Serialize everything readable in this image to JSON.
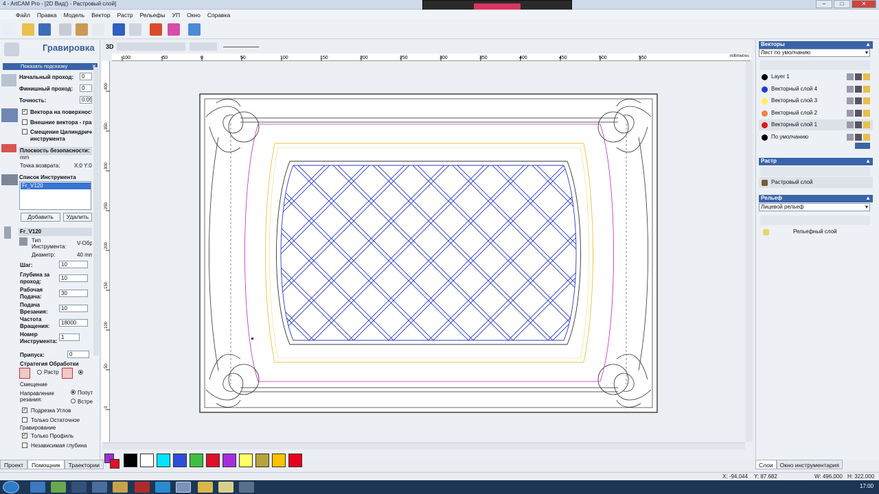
{
  "window": {
    "title": "4 - ArtCAM Pro - [2D Вид() - Растровый слой]"
  },
  "menu": [
    "Файл",
    "Правка",
    "Модель",
    "Вектор",
    "Растр",
    "Рельефы",
    "УП",
    "Окно",
    "Справка"
  ],
  "left_panel": {
    "title": "Гравировка",
    "hint": "Показать подсказку",
    "start_pass_label": "Начальный проход:",
    "start_pass": "0",
    "finish_pass_label": "Финишный проход:",
    "finish_pass": "0",
    "accuracy_label": "Точность:",
    "accuracy": "0.05",
    "vectors_surface": "Вектора на поверхности",
    "outer_vectors": "Внешние вектора - гравировка",
    "offset_cyl": "Смещение Цилиндрического",
    "offset_cyl2": "инструмента",
    "safe_plane": "Плоскость безопасности:",
    "safe_plane_unit": "mm",
    "return_point_label": "Точка возврата:",
    "return_point": "X:0 Y:0",
    "tool_list_label": "Список Инструмента",
    "tool_selected": "Fr_V120",
    "add_button": "Добавить",
    "delete_button": "Удалить",
    "tool_name": "Fr_V120",
    "tool_type_label": "Тип",
    "tool_type_label2": "Инструмента:",
    "tool_type": "V-Образный",
    "diameter_label": "Диаметр:",
    "diameter": "40 mm",
    "step_label": "Шаг:",
    "step": "10",
    "depth_label": "Глубина за",
    "depth_label2": "проход:",
    "depth": "10",
    "feed_label": "Рабочая",
    "feed_label2": "Подача:",
    "feed": "30",
    "plunge_label": "Подача",
    "plunge_label2": "Врезания:",
    "plunge": "10",
    "speed_label": "Частота",
    "speed_label2": "Вращения:",
    "speed": "18000",
    "toolnum_label": "Номер",
    "toolnum_label2": "Инструмента:",
    "toolnum": "1",
    "allowance_label": "Припуск:",
    "allowance": "0",
    "strategy_label": "Стратегия Обработки",
    "strategy_raster": "Растр",
    "offset_label": "Смещение",
    "direction_label": "Направление",
    "direction_label2": "резания:",
    "dir_climb": "Попутное",
    "dir_conv": "Встречное",
    "corner_trim": "Подрезка Углов",
    "residual_engrave": "Только Остаточное",
    "residual_engrave2": "Гравирование",
    "profile_only": "Только Профиль",
    "independent_depth": "Независимая глубина",
    "tabs": [
      "Проект",
      "Помощник",
      "Траектории"
    ]
  },
  "view": {
    "mode_label": "3D",
    "ruler_unit": "millimetres",
    "ruler_top": [
      "-100",
      "-50",
      "0",
      "50",
      "100",
      "150",
      "200",
      "250",
      "300",
      "350",
      "400",
      "450",
      "500",
      "550"
    ],
    "ruler_left": [
      "400",
      "350",
      "300",
      "250",
      "200",
      "150",
      "100",
      "50",
      "0"
    ]
  },
  "swatches": [
    "#000000",
    "#ffffff",
    "#00e5ff",
    "#2b4fd8",
    "#3fbf3f",
    "#e0102a",
    "#a62ee0",
    "#ffff66",
    "#b7a33b",
    "#ffc000",
    "#e8001c"
  ],
  "swatch_current": {
    "fg": "#9b30d9",
    "bg": "#e0102a"
  },
  "right_panel": {
    "vectors_title": "Векторы",
    "vectors_sheet": "Лист по умолчанию",
    "vector_layers": [
      {
        "name": "Layer 1",
        "color": "#000000"
      },
      {
        "name": "Векторный слой 4",
        "color": "#1f3bd6"
      },
      {
        "name": "Векторный слой 3",
        "color": "#fff04a"
      },
      {
        "name": "Векторный слой 2",
        "color": "#f08040"
      },
      {
        "name": "Векторный слой 1",
        "color": "#e01818"
      },
      {
        "name": "По умолчанию",
        "color": "#000000"
      }
    ],
    "raster_title": "Растр",
    "raster_layer": "Растровый слой",
    "relief_title": "Рельеф",
    "relief_select": "Лицевой рельеф",
    "relief_layer": "Рельефный слой",
    "tabs": [
      "Слои",
      "Окно инструментария"
    ]
  },
  "status": {
    "x": "X: -94.044",
    "y": "Y: 87.682",
    "w": "W: 496.000",
    "h": "H: 322.000"
  },
  "taskbar": {
    "clock": "17:00"
  }
}
